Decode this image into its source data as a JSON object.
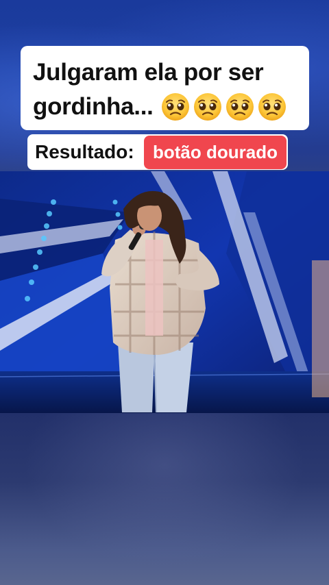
{
  "overlay": {
    "title_line1": "Julgaram ela por ser",
    "title_line2": "gordinha...",
    "title_emojis": [
      "pleading-face-icon",
      "pleading-face-icon",
      "pleading-face-icon",
      "pleading-face-icon"
    ],
    "result_label": "Resultado:",
    "result_value": "botão dourado"
  },
  "colors": {
    "badge": "#f0464e",
    "card": "#ffffff",
    "stage_blue": "#1436b8",
    "background": "#1e3a8f"
  }
}
